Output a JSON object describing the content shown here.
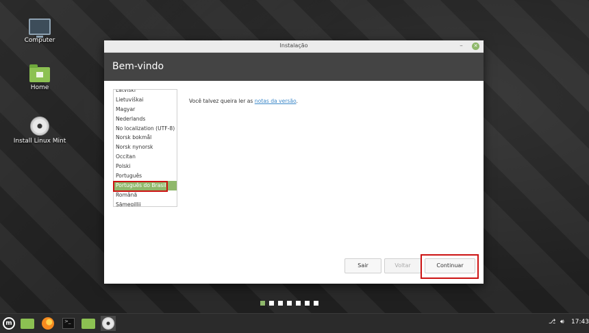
{
  "desktop": {
    "icons": [
      {
        "label": "Computer",
        "icon": "computer-icon"
      },
      {
        "label": "Home",
        "icon": "home-folder-icon"
      },
      {
        "label": "Install Linux Mint",
        "icon": "disc-icon"
      }
    ]
  },
  "window": {
    "title": "Instalação",
    "header": "Bem-vindo",
    "languages": [
      "Latviski",
      "Lietuviškai",
      "Magyar",
      "Nederlands",
      "No localization (UTF-8)",
      "Norsk bokmål",
      "Norsk nynorsk",
      "Occitan",
      "Polski",
      "Português",
      "Português do Brasil",
      "Română",
      "Sämegillii"
    ],
    "selected_language": "Português do Brasil",
    "notes_prefix": "Você talvez queira ler as ",
    "notes_link": "notas da versão",
    "notes_suffix": ".",
    "buttons": {
      "quit": "Sair",
      "back": "Voltar",
      "continue": "Continuar"
    },
    "progress": {
      "total_steps": 7,
      "current_step": 1
    }
  },
  "taskbar": {
    "clock": "17:43"
  },
  "colors": {
    "accent": "#8fb86b",
    "highlight": "#cc1111"
  }
}
